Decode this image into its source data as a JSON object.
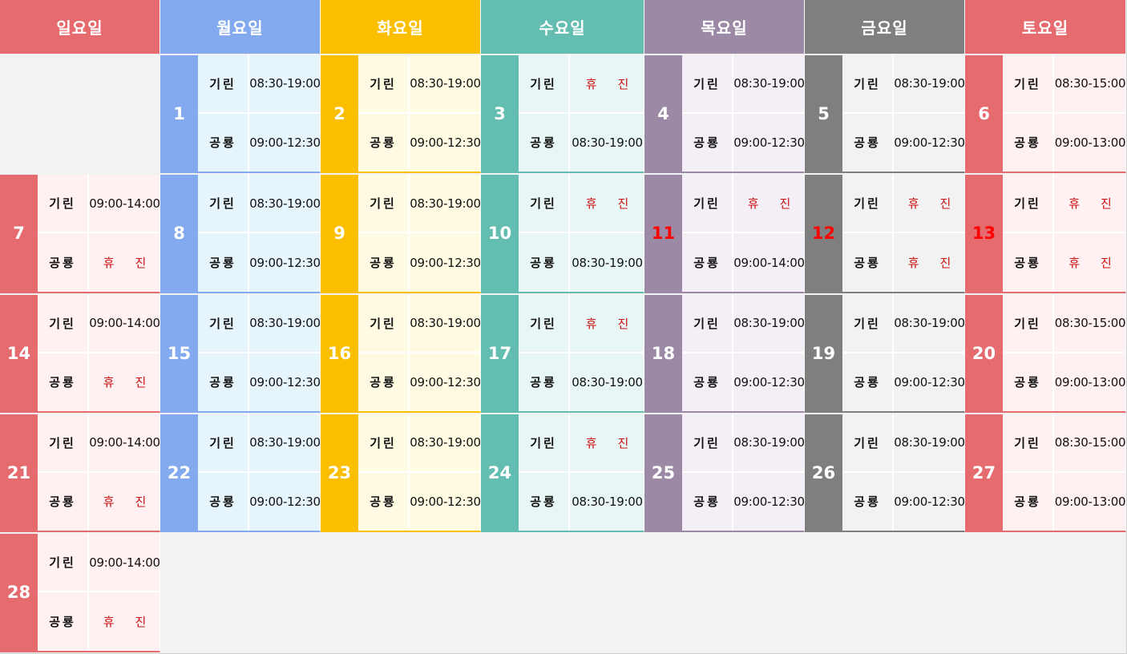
{
  "weekdays": [
    {
      "label": "일요일",
      "color": "#e56b6f",
      "light": "#fff0f1"
    },
    {
      "label": "월요일",
      "color": "#83aaee",
      "light": "#e6f4fb"
    },
    {
      "label": "화요일",
      "color": "#fbbf00",
      "light": "#fffbe2"
    },
    {
      "label": "수요일",
      "color": "#64bdb1",
      "light": "#e8f7f5"
    },
    {
      "label": "목요일",
      "color": "#9c89a5",
      "light": "#f4eef6"
    },
    {
      "label": "금요일",
      "color": "#7f7f7f",
      "light": "#f2f2f2"
    },
    {
      "label": "토요일",
      "color": "#e56b6f",
      "light": "#fff0f1"
    }
  ],
  "clinics": {
    "a": "기린",
    "b": "공룡"
  },
  "days": [
    {
      "n": "1",
      "col": 1,
      "wk": 0,
      "a": "08:30-19:00",
      "b": "09:00-12:30"
    },
    {
      "n": "2",
      "col": 2,
      "wk": 0,
      "a": "08:30-19:00",
      "b": "09:00-12:30"
    },
    {
      "n": "3",
      "col": 3,
      "wk": 0,
      "a": "휴진",
      "b": "08:30-19:00"
    },
    {
      "n": "4",
      "col": 4,
      "wk": 0,
      "a": "08:30-19:00",
      "b": "09:00-12:30"
    },
    {
      "n": "5",
      "col": 5,
      "wk": 0,
      "a": "08:30-19:00",
      "b": "09:00-12:30"
    },
    {
      "n": "6",
      "col": 6,
      "wk": 0,
      "a": "08:30-15:00",
      "b": "09:00-13:00"
    },
    {
      "n": "7",
      "col": 0,
      "wk": 1,
      "a": "09:00-14:00",
      "b": "휴진"
    },
    {
      "n": "8",
      "col": 1,
      "wk": 1,
      "a": "08:30-19:00",
      "b": "09:00-12:30"
    },
    {
      "n": "9",
      "col": 2,
      "wk": 1,
      "a": "08:30-19:00",
      "b": "09:00-12:30"
    },
    {
      "n": "10",
      "col": 3,
      "wk": 1,
      "a": "휴진",
      "b": "08:30-19:00"
    },
    {
      "n": "11",
      "col": 4,
      "wk": 1,
      "a": "휴진",
      "b": "09:00-14:00",
      "holiday": true
    },
    {
      "n": "12",
      "col": 5,
      "wk": 1,
      "a": "휴진",
      "b": "휴진",
      "holiday": true
    },
    {
      "n": "13",
      "col": 6,
      "wk": 1,
      "a": "휴진",
      "b": "휴진",
      "holiday": true
    },
    {
      "n": "14",
      "col": 0,
      "wk": 2,
      "a": "09:00-14:00",
      "b": "휴진"
    },
    {
      "n": "15",
      "col": 1,
      "wk": 2,
      "a": "08:30-19:00",
      "b": "09:00-12:30"
    },
    {
      "n": "16",
      "col": 2,
      "wk": 2,
      "a": "08:30-19:00",
      "b": "09:00-12:30"
    },
    {
      "n": "17",
      "col": 3,
      "wk": 2,
      "a": "휴진",
      "b": "08:30-19:00"
    },
    {
      "n": "18",
      "col": 4,
      "wk": 2,
      "a": "08:30-19:00",
      "b": "09:00-12:30"
    },
    {
      "n": "19",
      "col": 5,
      "wk": 2,
      "a": "08:30-19:00",
      "b": "09:00-12:30"
    },
    {
      "n": "20",
      "col": 6,
      "wk": 2,
      "a": "08:30-15:00",
      "b": "09:00-13:00"
    },
    {
      "n": "21",
      "col": 0,
      "wk": 3,
      "a": "09:00-14:00",
      "b": "휴진"
    },
    {
      "n": "22",
      "col": 1,
      "wk": 3,
      "a": "08:30-19:00",
      "b": "09:00-12:30"
    },
    {
      "n": "23",
      "col": 2,
      "wk": 3,
      "a": "08:30-19:00",
      "b": "09:00-12:30"
    },
    {
      "n": "24",
      "col": 3,
      "wk": 3,
      "a": "휴진",
      "b": "08:30-19:00"
    },
    {
      "n": "25",
      "col": 4,
      "wk": 3,
      "a": "08:30-19:00",
      "b": "09:00-12:30"
    },
    {
      "n": "26",
      "col": 5,
      "wk": 3,
      "a": "08:30-19:00",
      "b": "09:00-12:30"
    },
    {
      "n": "27",
      "col": 6,
      "wk": 3,
      "a": "08:30-15:00",
      "b": "09:00-13:00"
    },
    {
      "n": "28",
      "col": 0,
      "wk": 4,
      "a": "09:00-14:00",
      "b": "휴진"
    }
  ]
}
